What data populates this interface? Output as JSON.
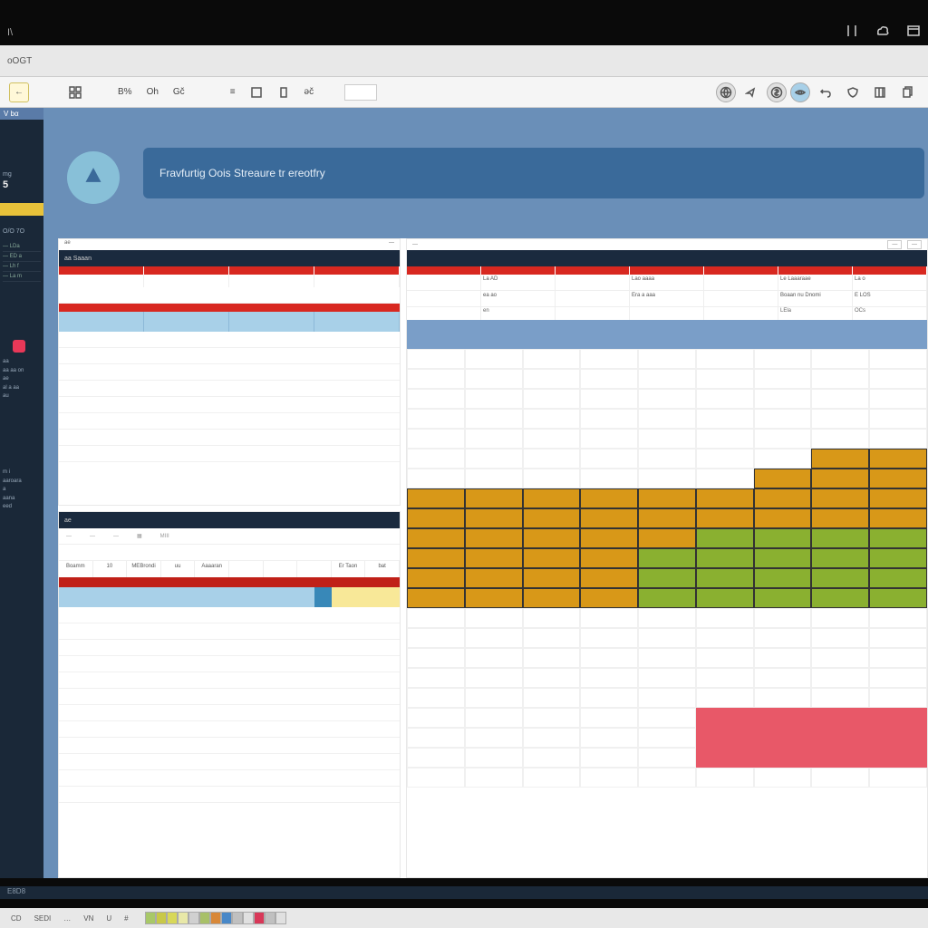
{
  "os_bar": {
    "left": "I\\"
  },
  "browser": {
    "url": "oOGT"
  },
  "toolbar": {
    "btn1": "←",
    "items": [
      "⊞",
      "B%",
      "Oh",
      "Gč"
    ],
    "mid": [
      "≡",
      "▢",
      "▯",
      "ǝč"
    ]
  },
  "sidebar": {
    "tab": "V bα",
    "title1": "mg",
    "count": "5",
    "sec2": "O/O 7O",
    "lines": [
      "— LDa",
      "— ED a",
      "— Lh f",
      "— La m"
    ],
    "paras": [
      "aa",
      "aa aa on",
      "ae",
      "al a aa",
      "au"
    ],
    "fparas": [
      "m i",
      "aaroara",
      "a",
      "aana",
      "eed"
    ]
  },
  "banner": {
    "title": "Fravfurtig Oois Streaure tr ereotfry"
  },
  "panel_tl": {
    "hdr_l": "ae",
    "hdr_r": "—",
    "navy": "aa Saaan",
    "cols": [
      "",
      "",
      "",
      ""
    ]
  },
  "panel_bl": {
    "hdr_l": "ae",
    "tb": [
      "—",
      "—",
      "—",
      "▦",
      "MIII"
    ],
    "dates": [
      "Boamm",
      "10",
      "MEBrondi",
      "uu",
      "Aaaaran",
      "",
      "",
      "",
      "Er Taon",
      "bat"
    ]
  },
  "panel_r": {
    "hdr_l": "—",
    "hdr_btn1": "—",
    "hdr_btn2": "—",
    "navy_mid": "—",
    "cols1": [
      "",
      "La AD",
      "",
      "Lao aaaa",
      "",
      "Le Laaaraae",
      "La o"
    ],
    "cols2": [
      "",
      "ea ao",
      "",
      "Era a aaa",
      "",
      "Boaan nu Dnomi",
      "E LOS"
    ],
    "cols3": [
      "",
      "en",
      "",
      "",
      "",
      "LEla",
      "OCs"
    ]
  },
  "footer": {
    "left": "E8D8"
  },
  "taskbar": {
    "items": [
      "CD",
      "SEDI",
      "…",
      "VN",
      "U",
      "#"
    ],
    "app_colors": [
      "#a8c868",
      "#c8c848",
      "#d8d858",
      "#e8e8a8",
      "#d0d0d0",
      "#a8c068",
      "#d88838",
      "#4888c8",
      "#c0c0c0",
      "#e0e0e0",
      "#d83858",
      "#c0c0c0",
      "#e0e0e0"
    ]
  },
  "colors": {
    "orange": "#d89818",
    "green": "#8ab030",
    "pink": "#e85868"
  }
}
